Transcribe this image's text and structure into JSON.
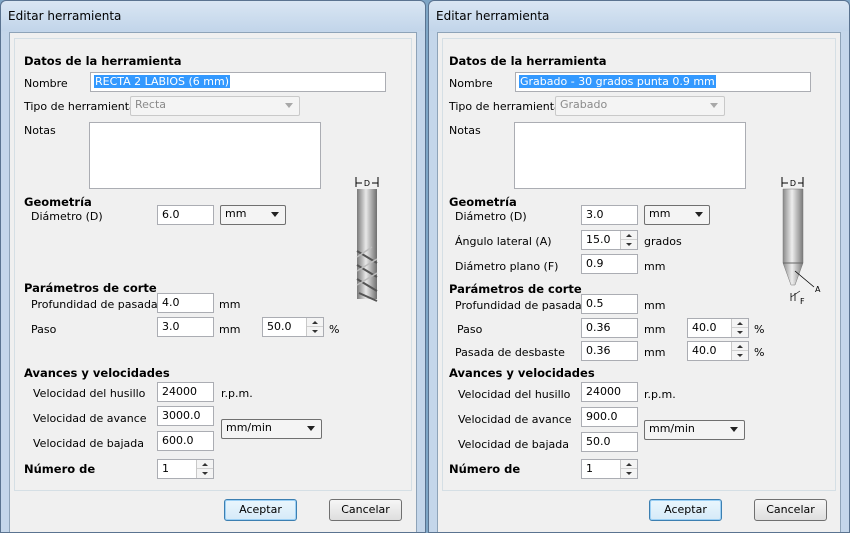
{
  "left": {
    "title": "Editar herramienta",
    "sec_datos": "Datos de la herramienta",
    "nombre_label": "Nombre",
    "nombre_value": "RECTA 2 LABIOS (6 mm)",
    "tipo_label": "Tipo de herramienta",
    "tipo_value": "Recta",
    "notas_label": "Notas",
    "sec_geo": "Geometría",
    "diametro_label": "Diámetro (D)",
    "diametro_value": "6.0",
    "unit_value": "mm",
    "sec_corte": "Parámetros de corte",
    "prof_label": "Profundidad de pasada",
    "prof_value": "4.0",
    "prof_unit": "mm",
    "paso_label": "Paso",
    "paso_value": "3.0",
    "paso_unit": "mm",
    "paso_pct": "50.0",
    "pct": "%",
    "sec_avances": "Avances y velocidades",
    "husillo_label": "Velocidad del husillo",
    "husillo_value": "24000",
    "husillo_unit": "r.p.m.",
    "avance_label": "Velocidad de avance",
    "avance_value": "3000.0",
    "bajada_label": "Velocidad de bajada",
    "bajada_value": "600.0",
    "feed_unit": "mm/min",
    "sec_numero": "Número de",
    "numero_value": "1",
    "accept": "Aceptar",
    "cancel": "Cancelar",
    "diagram_label": "D"
  },
  "right": {
    "title": "Editar herramienta",
    "sec_datos": "Datos de la herramienta",
    "nombre_label": "Nombre",
    "nombre_value": "Grabado - 30 grados punta 0.9  mm",
    "tipo_label": "Tipo de herramienta",
    "tipo_value": "Grabado",
    "notas_label": "Notas",
    "sec_geo": "Geometría",
    "diametro_label": "Diámetro (D)",
    "diametro_value": "3.0",
    "unit_value": "mm",
    "angulo_label": "Ángulo lateral (A)",
    "angulo_value": "15.0",
    "angulo_unit": "grados",
    "plano_label": "Diámetro plano (F)",
    "plano_value": "0.9",
    "plano_unit": "mm",
    "sec_corte": "Parámetros de corte",
    "prof_label": "Profundidad de pasada",
    "prof_value": "0.5",
    "prof_unit": "mm",
    "paso_label": "Paso",
    "paso_value": "0.36",
    "paso_unit": "mm",
    "paso_pct": "40.0",
    "desbaste_label": "Pasada de desbaste",
    "desbaste_value": "0.36",
    "desbaste_unit": "mm",
    "desbaste_pct": "40.0",
    "pct": "%",
    "sec_avances": "Avances y velocidades",
    "husillo_label": "Velocidad del husillo",
    "husillo_value": "24000",
    "husillo_unit": "r.p.m.",
    "avance_label": "Velocidad de avance",
    "avance_value": "900.0",
    "bajada_label": "Velocidad de bajada",
    "bajada_value": "50.0",
    "feed_unit": "mm/min",
    "sec_numero": "Número de",
    "numero_value": "1",
    "accept": "Aceptar",
    "cancel": "Cancelar",
    "diagram_d": "D",
    "diagram_a": "A",
    "diagram_f": "F"
  }
}
